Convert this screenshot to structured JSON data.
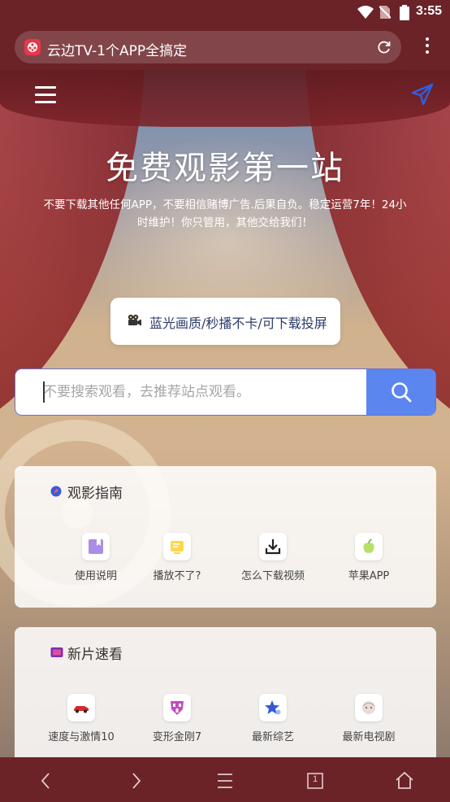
{
  "status_bar": {
    "time": "3:55"
  },
  "browser": {
    "page_title": "云边TV-1个APP全搞定"
  },
  "hero": {
    "title": "免费观影第一站",
    "subtitle": "不要下载其他任何APP，不要相信赌博广告.后果自负。稳定运营7年！24小时维护！你只管用，其他交给我们！"
  },
  "feature_pill": {
    "label": "蓝光画质/秒播不卡/可下载投屏"
  },
  "search": {
    "placeholder": "不要搜索观看，去推荐站点观看。"
  },
  "guide": {
    "title": "观影指南",
    "items": [
      {
        "label": "使用说明",
        "icon": "book-icon"
      },
      {
        "label": "播放不了?",
        "icon": "player-icon"
      },
      {
        "label": "怎么下载视频",
        "icon": "download-icon"
      },
      {
        "label": "苹果APP",
        "icon": "apple-icon"
      }
    ]
  },
  "new_releases": {
    "title": "新片速看",
    "items": [
      {
        "label": "速度与激情10",
        "icon": "car-icon"
      },
      {
        "label": "变形金刚7",
        "icon": "robot-icon"
      },
      {
        "label": "最新综艺",
        "icon": "star-icon"
      },
      {
        "label": "最新电视剧",
        "icon": "face-icon"
      }
    ]
  },
  "nav_bar": {
    "tab_count": "1"
  },
  "colors": {
    "chrome": "#6b2328",
    "accent": "#5b86ef",
    "pill_text": "#2b3a6b"
  }
}
